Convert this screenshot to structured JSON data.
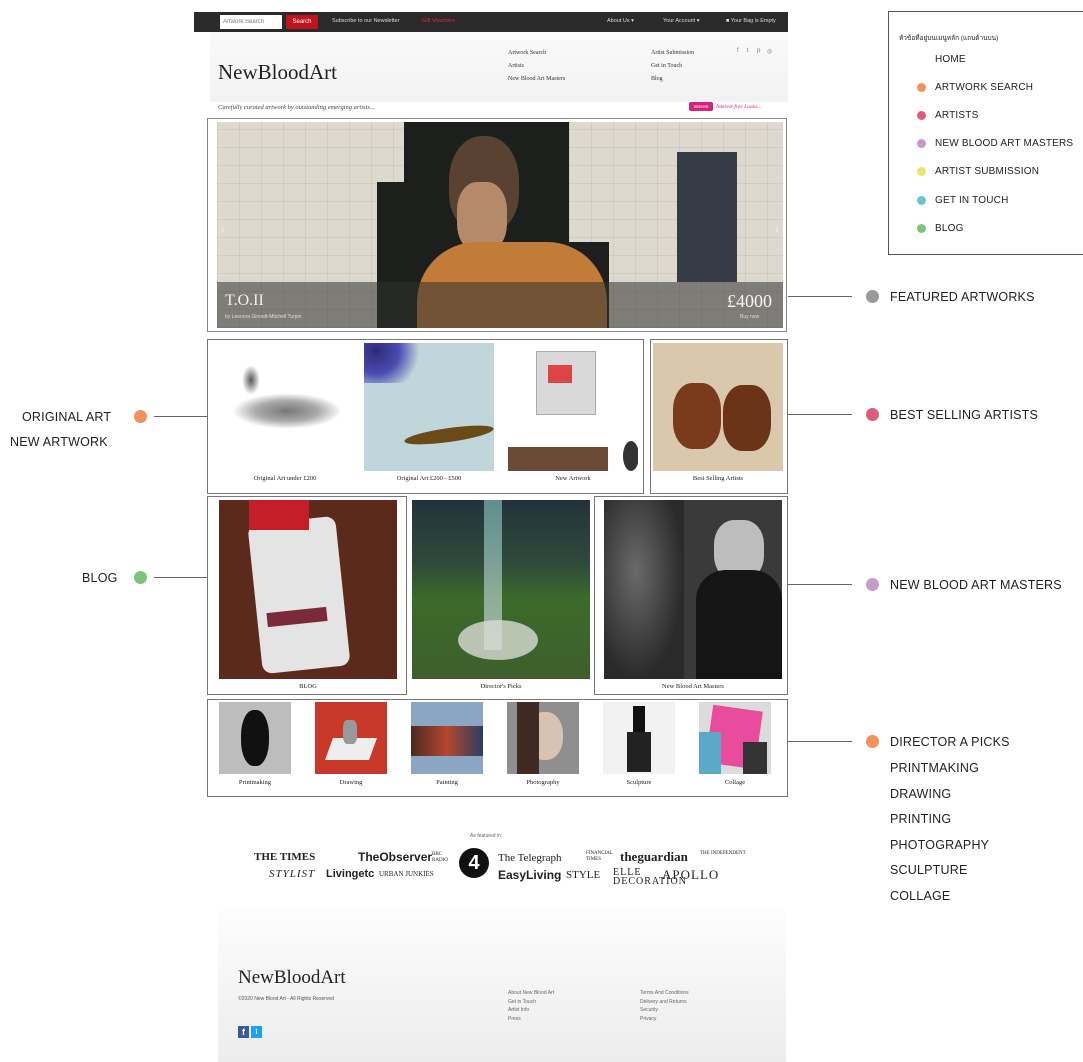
{
  "site": {
    "topbar": {
      "search_placeholder": "Artwork Search",
      "search_button": "Search",
      "newsletter": "Subscribe to our Newsletter",
      "gift": "Gift Vouchers",
      "about": "About Us",
      "account": "Your Account",
      "bag": "Your Bag is Empty"
    },
    "logo": "NewBloodArt",
    "nav": {
      "col1": [
        "Artwork Search",
        "Artists",
        "New Blood Art Masters"
      ],
      "col2": [
        "Artist Submission",
        "Get in Touch",
        "Blog"
      ]
    },
    "social_icons": [
      "facebook-icon",
      "twitter-icon",
      "pinterest-icon",
      "instagram-icon"
    ],
    "tagline": "Carefully curated artwork by outstanding emerging artists...",
    "promo": {
      "badge": "Interest Free",
      "text": "Interest-free Loans..."
    },
    "hero": {
      "title": "T.O.II",
      "artist": "by Leonora Ginnett-Mitchell Turpin",
      "price": "£4000",
      "price_sub": "Buy now"
    },
    "row1": {
      "items": [
        "Original Art under £200",
        "Original Art £200 - £500",
        "New Artwork"
      ],
      "best_selling": "Best Selling Artists"
    },
    "row2": {
      "blog": "BLOG",
      "directors": "Director's Picks",
      "masters": "New Blood Art Masters"
    },
    "categories": [
      "Printmaking",
      "Drawing",
      "Painting",
      "Photography",
      "Sculpture",
      "Collage"
    ],
    "featured_in": {
      "label": "As featured in:",
      "row1": [
        "THE TIMES",
        "TheObserver",
        "BBC RADIO",
        "The Telegraph",
        "FINANCIAL TIMES",
        "theguardian",
        "THE INDEPENDENT"
      ],
      "row2": [
        "STYLIST",
        "Livingetc",
        "URBAN JUNKIES",
        "EasyLiving",
        "STYLE",
        "ELLE DECORATION",
        "APOLLO"
      ],
      "channel4": "4"
    },
    "footer": {
      "logo": "NewBloodArt",
      "copyright": "©2020 New Blood Art - All Rights Reserved",
      "links_col1": [
        "About New Blood Art",
        "Get in Touch",
        "Artist Info",
        "Press"
      ],
      "links_col2": [
        "Terms And Conditions",
        "Delivery and Returns",
        "Security",
        "Privacy"
      ]
    }
  },
  "legend": {
    "title": "หัวข้อที่อยู่บนเมนูหลัก (แถบด้านบน)",
    "items": [
      {
        "label": "HOME",
        "color": ""
      },
      {
        "label": "ARTWORK SEARCH",
        "color": "#f0925a"
      },
      {
        "label": "ARTISTS",
        "color": "#e05a7c"
      },
      {
        "label": "NEW BLOOD ART MASTERS",
        "color": "#c79ac8"
      },
      {
        "label": "ARTIST SUBMISSION",
        "color": "#ece56a"
      },
      {
        "label": "GET IN TOUCH",
        "color": "#6cc7cc"
      },
      {
        "label": "BLOG",
        "color": "#7cc47c"
      }
    ]
  },
  "annotations": {
    "featured": {
      "label": "FEATURED ARTWORKS",
      "color": "#9a9a9a"
    },
    "original": {
      "lines": [
        "ORIGINAL ART",
        "NEW ARTWORK"
      ],
      "color": "#f0925a"
    },
    "best": {
      "label": "BEST SELLING ARTISTS",
      "color": "#e05a7c"
    },
    "blog": {
      "label": "BLOG",
      "color": "#7cc47c"
    },
    "masters": {
      "label": "NEW BLOOD ART MASTERS",
      "color": "#c79ac8"
    },
    "director": {
      "lines": [
        "DIRECTOR A PICKS",
        "PRINTMAKING",
        "DRAWING",
        "PRINTING",
        "PHOTOGRAPHY",
        "SCULPTURE",
        "COLLAGE"
      ],
      "color": "#f0925a"
    }
  }
}
